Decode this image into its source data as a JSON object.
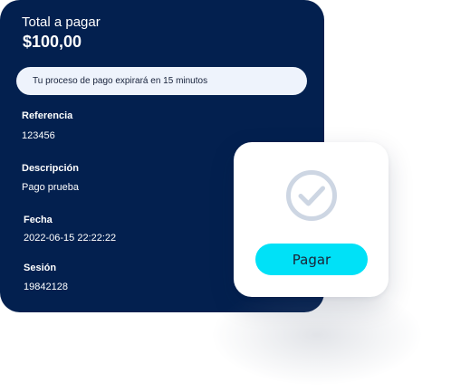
{
  "total": {
    "label": "Total a pagar",
    "amount": "$100,00"
  },
  "expiry_notice": "Tu proceso de pago expirará en 15 minutos",
  "fields": {
    "reference": {
      "label": "Referencia",
      "value": "123456"
    },
    "description": {
      "label": "Descripción",
      "value": "Pago prueba"
    },
    "date": {
      "label": "Fecha",
      "value": "2022-06-15 22:22:22"
    },
    "session": {
      "label": "Sesión",
      "value": "19842128"
    }
  },
  "pay_card": {
    "icon": "check-circle-icon",
    "button_label": "Pagar"
  },
  "colors": {
    "card_background": "#03204f",
    "banner_background": "#eef3fc",
    "button_accent": "#00e1f7",
    "check_icon": "#cdd6e3"
  }
}
